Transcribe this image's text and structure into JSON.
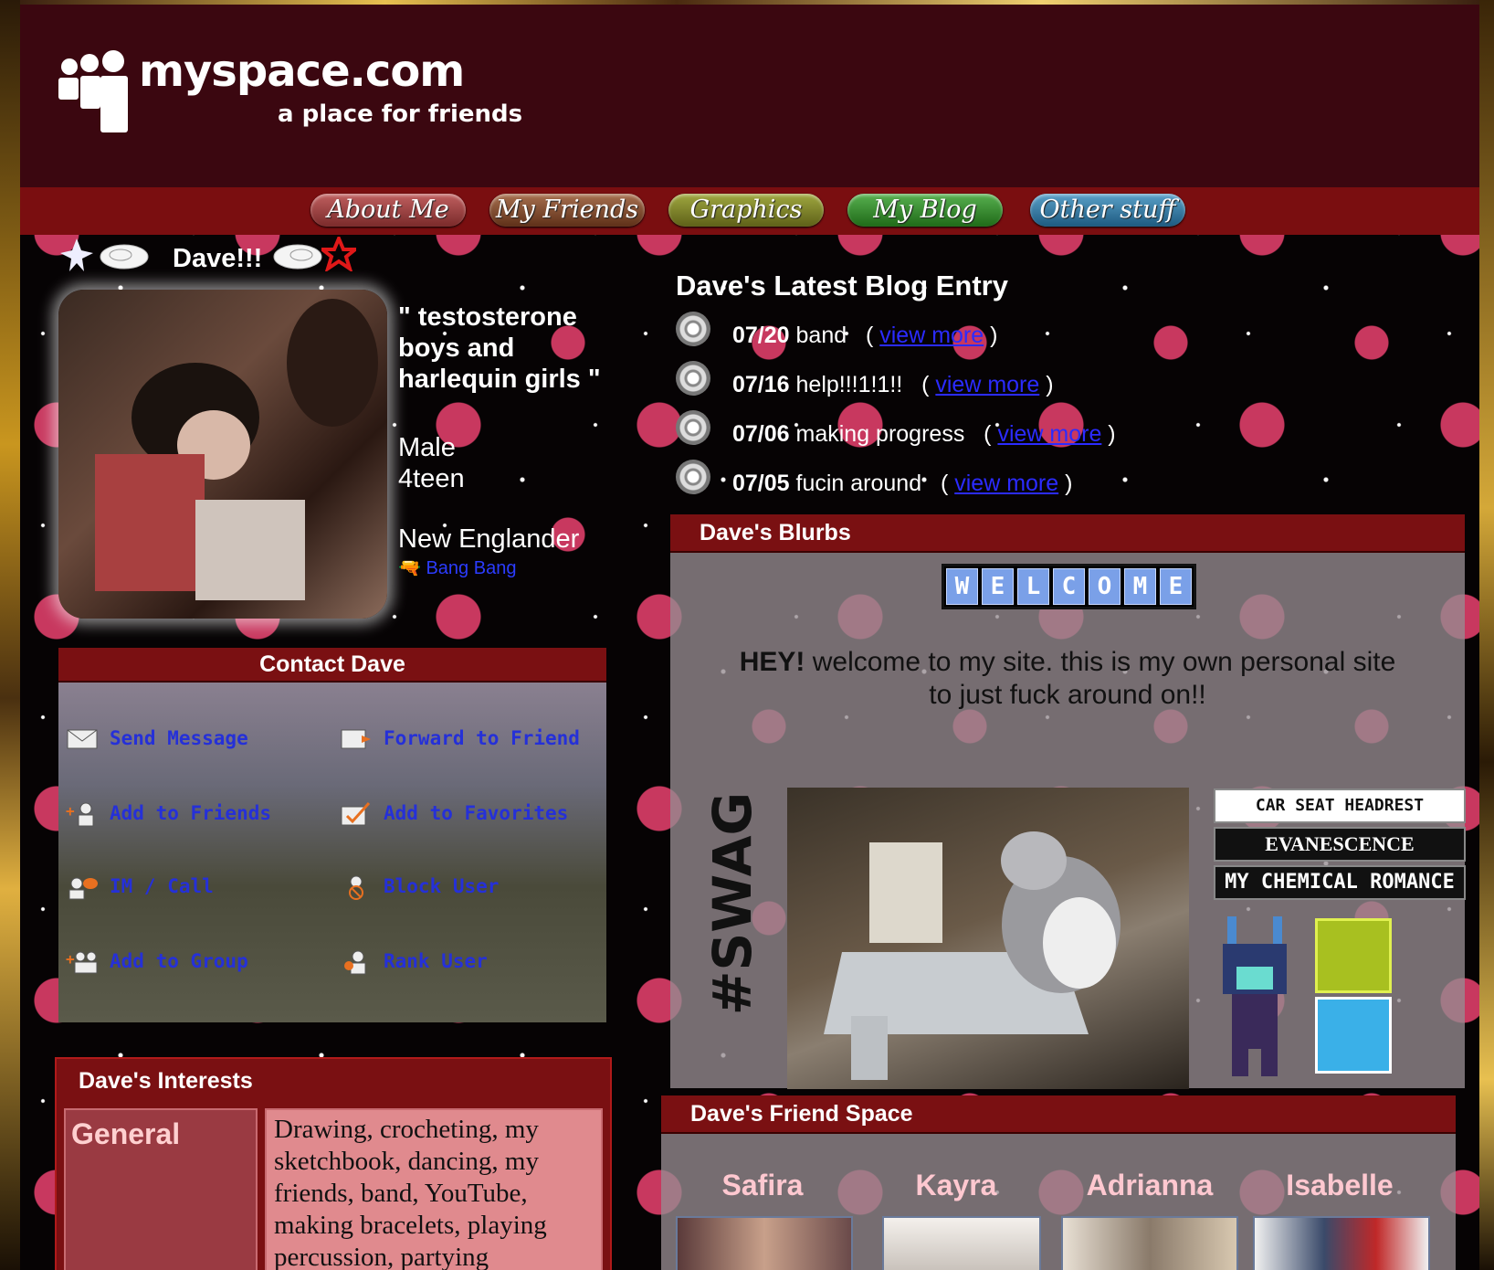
{
  "site": {
    "logo_text": "myspace.com",
    "tagline": "a place for friends"
  },
  "nav": [
    "About Me",
    "My Friends",
    "Graphics",
    "My Blog",
    "Other stuff"
  ],
  "profile": {
    "name": "Dave!!!",
    "headline": "\" testosterone boys and harlequin girls \"",
    "gender": "Male",
    "age": "4teen",
    "location": "New Englander",
    "mood": "Bang Bang"
  },
  "contact": {
    "title": "Contact Dave",
    "actions": [
      "Send Message",
      "Forward to Friend",
      "Add to Friends",
      "Add to Favorites",
      "IM / Call",
      "Block User",
      "Add to Group",
      "Rank User"
    ]
  },
  "interests": {
    "title": "Dave's Interests",
    "category": "General",
    "value": "Drawing, crocheting, my sketchbook, dancing, my friends, band, YouTube, making bracelets, playing percussion, partying"
  },
  "blog": {
    "title": "Dave's Latest Blog Entry",
    "link_label": "view more",
    "entries": [
      {
        "date": "07/20",
        "title": "band"
      },
      {
        "date": "07/16",
        "title": "help!!!1!1!!"
      },
      {
        "date": "07/06",
        "title": "making progress"
      },
      {
        "date": "07/05",
        "title": "fucin around"
      }
    ]
  },
  "blurbs": {
    "title": "Dave's Blurbs",
    "welcome_letters": [
      "W",
      "E",
      "L",
      "C",
      "O",
      "M",
      "E"
    ],
    "text_bold": "HEY!",
    "text": " welcome to my site. this is my own personal site to just fuck around on!!",
    "swag": "#SWAG",
    "bands": [
      "CAR SEAT HEADREST",
      "EVANESCENCE",
      "MY CHEMICAL ROMANCE"
    ]
  },
  "friends": {
    "title": "Dave's Friend Space",
    "names": [
      "Safira",
      "Kayra",
      "Adrianna",
      "Isabelle"
    ]
  }
}
